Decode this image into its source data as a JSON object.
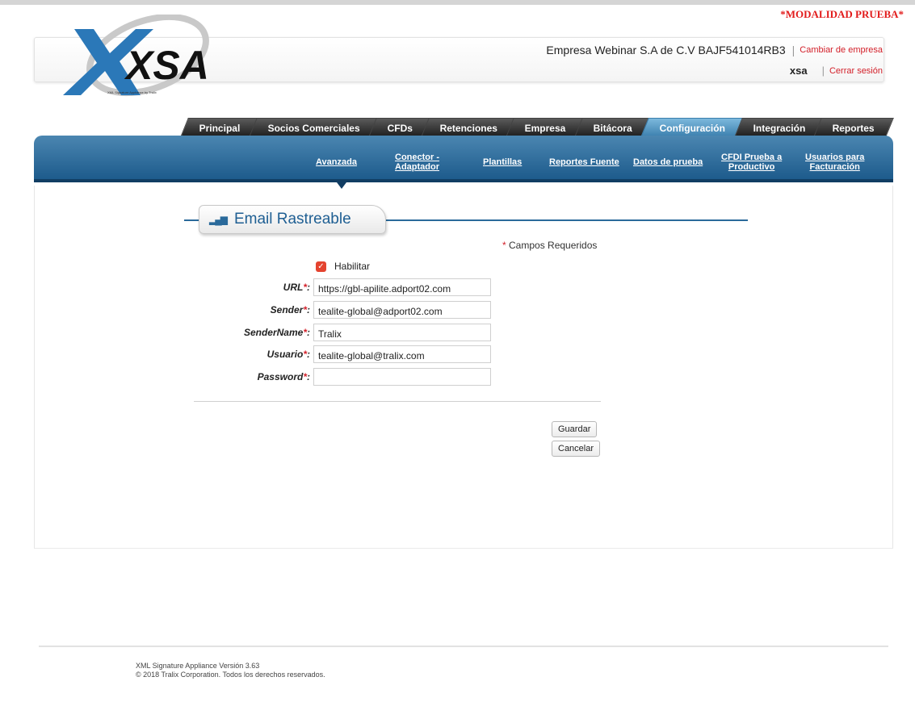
{
  "mode_banner": "*MODALIDAD PRUEBA*",
  "header": {
    "logo_text": "XSA",
    "logo_tagline": "XML Signature Appliance by Tralix",
    "company": "Empresa Webinar S.A de C.V BAJF541014RB3",
    "change_company": "Cambiar de empresa",
    "user": "xsa",
    "logout": "Cerrar sesión"
  },
  "tabs": [
    "Principal",
    "Socios Comerciales",
    "CFDs",
    "Retenciones",
    "Empresa",
    "Bitácora",
    "Configuración",
    "Integración",
    "Reportes"
  ],
  "active_tab": "Configuración",
  "subnav": {
    "avanzada": "Avanzada",
    "conector_1": "Conector -",
    "conector_2": "Adaptador",
    "plantillas": "Plantillas",
    "reportes_fuente": "Reportes Fuente",
    "datos_prueba": "Datos de prueba",
    "cfdi_1": "CFDI Prueba a",
    "cfdi_2": "Productivo",
    "usuarios_1": "Usuarios para",
    "usuarios_2": "Facturación"
  },
  "section": {
    "title": "Email Rastreable"
  },
  "required_note": "Campos Requeridos",
  "form": {
    "habilitar_label": "Habilitar",
    "habilitar_checked": true,
    "url_label": "URL",
    "url_value": "https://gbl-apilite.adport02.com",
    "sender_label": "Sender",
    "sender_value": "tealite-global@adport02.com",
    "sendername_label": "SenderName",
    "sendername_value": "Tralix",
    "usuario_label": "Usuario",
    "usuario_value": "tealite-global@tralix.com",
    "password_label": "Password",
    "password_value": ""
  },
  "buttons": {
    "save": "Guardar",
    "cancel": "Cancelar"
  },
  "footer": {
    "version": "XML Signature Appliance Versión 3.63",
    "copyright": "© 2018 Tralix Corporation. Todos los derechos reservados."
  },
  "colors": {
    "accent_blue": "#1d5b8c",
    "required_red": "#d3202a",
    "active_tab": "#5f9ccb"
  }
}
